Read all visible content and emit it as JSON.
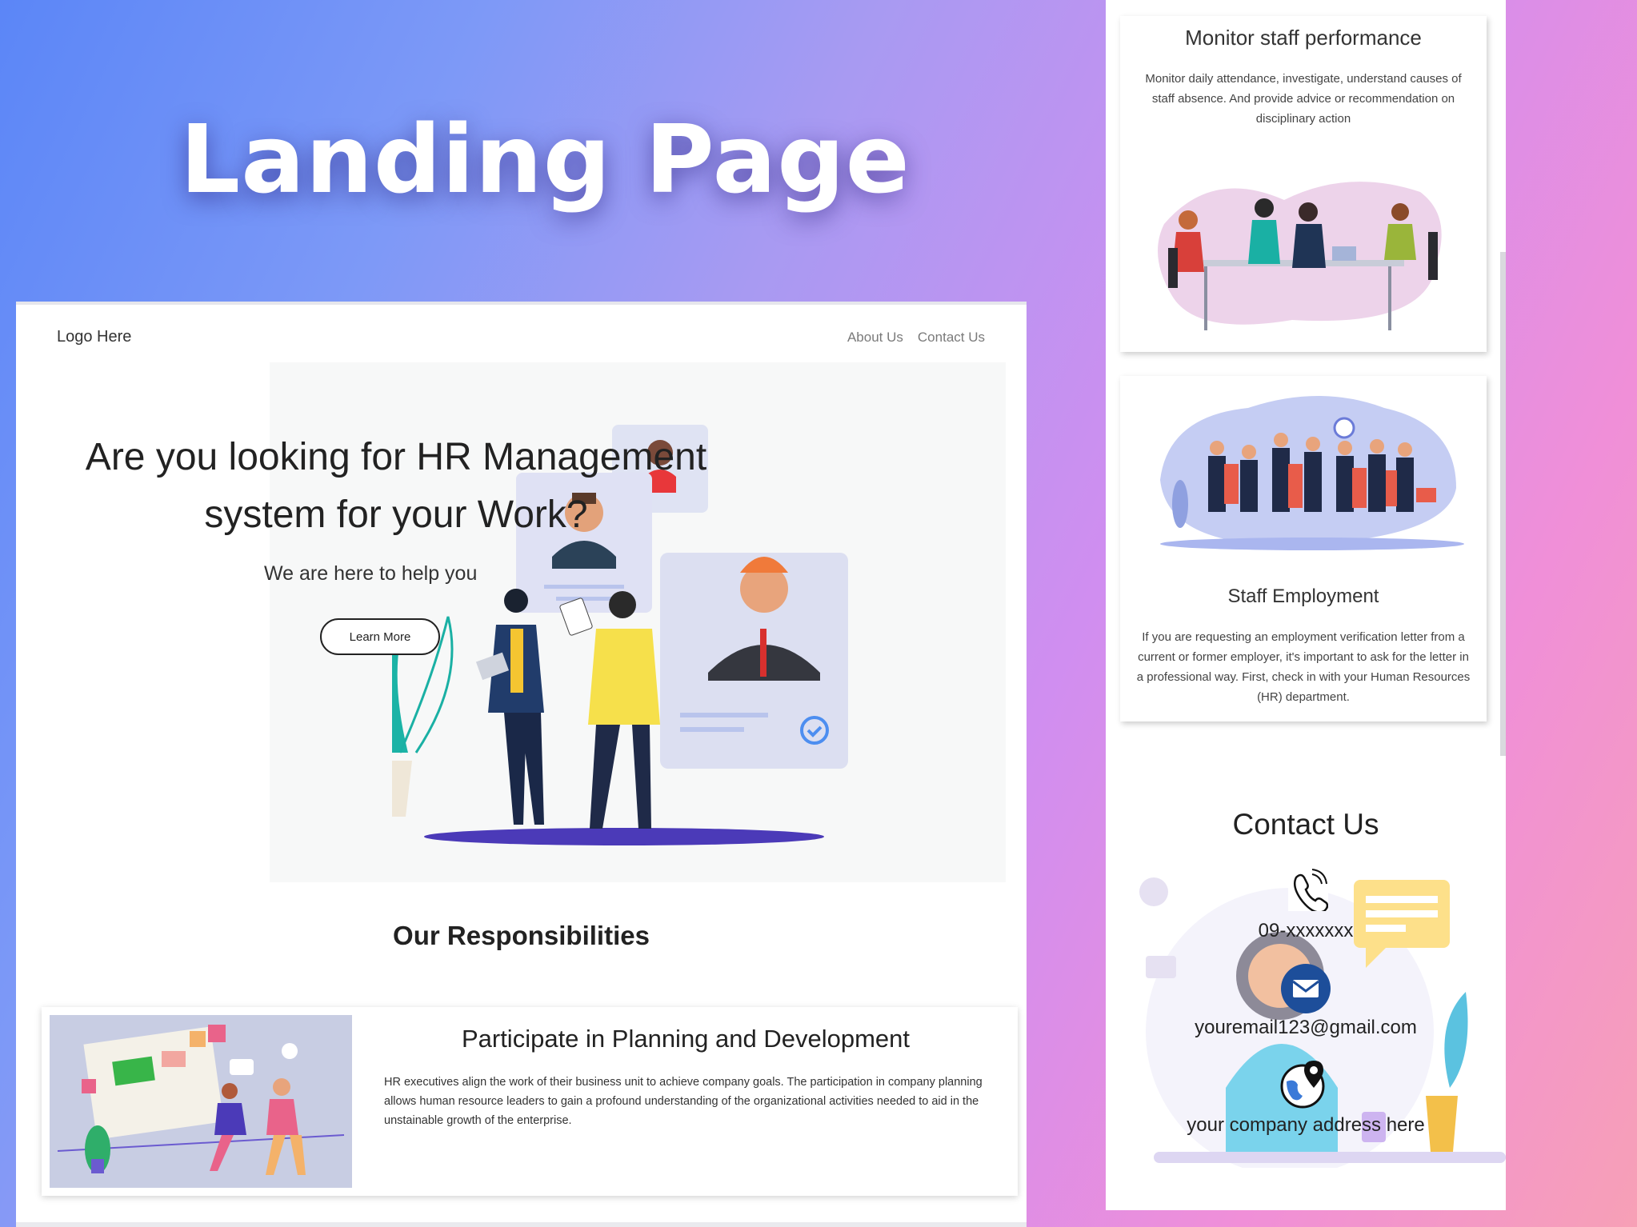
{
  "banner": {
    "title": "Landing Page"
  },
  "desktop": {
    "nav": {
      "logo": "Logo Here",
      "links": [
        "About Us",
        "Contact Us"
      ]
    },
    "hero": {
      "heading_line1": "Are you looking for HR Management",
      "heading_line2": "system for your Work?",
      "subtitle": "We are here to help you",
      "cta": "Learn More"
    },
    "responsibilities": {
      "title": "Our Responsibilities",
      "cards": [
        {
          "title": "Participate in Planning and Development",
          "body": "HR executives align the work of their business unit to achieve company goals. The participation in company planning allows human resource leaders to gain a profound understanding of the organizational activities needed to aid in the unstainable growth of the enterprise."
        }
      ]
    }
  },
  "mobile": {
    "cards": [
      {
        "title": "Monitor staff performance",
        "body": "Monitor daily attendance, investigate, understand causes of staff absence. And provide advice or recommendation on disciplinary action"
      },
      {
        "title": "Staff Employment",
        "body": "If you are requesting an employment verification letter from a current or former employer, it's important to ask for the letter in a professional way. First, check in with your Human Resources (HR) department."
      }
    ],
    "contact": {
      "title": "Contact Us",
      "phone": "09-xxxxxxx",
      "email": "youremail123@gmail.com",
      "address": "your company address here",
      "icons": [
        "phone-icon",
        "mail-icon",
        "location-icon"
      ]
    }
  },
  "colors": {
    "accent_blue": "#3f3fb5",
    "teal": "#22b3a8",
    "yellow": "#f7dc4a"
  }
}
